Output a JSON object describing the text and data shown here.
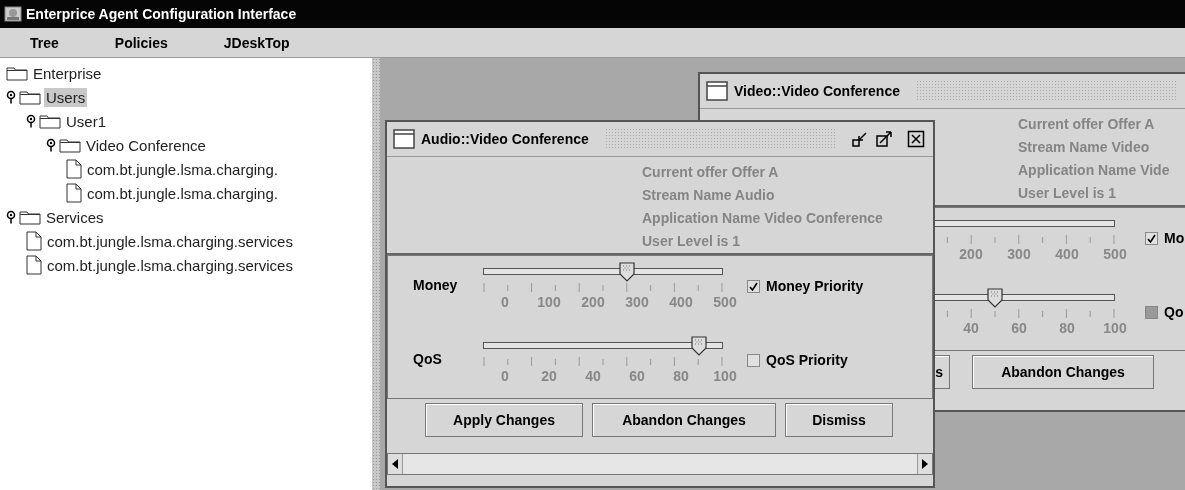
{
  "window": {
    "title": "Enterprice Agent Configuration Interface"
  },
  "menu": [
    {
      "label": "Tree"
    },
    {
      "label": "Policies"
    },
    {
      "label": "JDeskTop"
    }
  ],
  "tree": {
    "label": "Enterprise",
    "kind": "folder",
    "selected": false,
    "children": [
      {
        "label": "Users",
        "kind": "folder",
        "expanded": true,
        "selected": true,
        "children": [
          {
            "label": "User1",
            "kind": "folder",
            "expanded": true,
            "selected": false,
            "children": [
              {
                "label": "Video Conference",
                "kind": "folder",
                "expanded": true,
                "selected": false,
                "children": [
                  {
                    "label": "com.bt.jungle.lsma.charging.",
                    "kind": "leaf",
                    "selected": false
                  },
                  {
                    "label": "com.bt.jungle.lsma.charging.",
                    "kind": "leaf",
                    "selected": false
                  }
                ]
              }
            ]
          }
        ]
      },
      {
        "label": "Services",
        "kind": "folder",
        "expanded": true,
        "selected": false,
        "children": [
          {
            "label": "com.bt.jungle.lsma.charging.services",
            "kind": "leaf",
            "selected": false
          },
          {
            "label": "com.bt.jungle.lsma.charging.services",
            "kind": "leaf",
            "selected": false
          }
        ]
      }
    ]
  },
  "internal_frames": [
    {
      "title": "Video::Video Conference",
      "info_lines": [
        "Current offer Offer A",
        "Stream Name Video",
        "Application Name Vide",
        "User Level is  1"
      ],
      "sliders": [
        {
          "tick_labels": [
            "200",
            "300",
            "400",
            "500"
          ],
          "checkbox": {
            "label": "Mo",
            "checked": true,
            "disabled": false
          }
        },
        {
          "level": 0.5,
          "tick_labels": [
            "40",
            "60",
            "80",
            "100"
          ],
          "checkbox": {
            "label": "Qo",
            "checked": false,
            "disabled": true
          }
        }
      ],
      "buttons": [
        {
          "label": "s"
        },
        {
          "label": "Abandon Changes"
        }
      ]
    },
    {
      "title": "Audio::Video Conference",
      "title_controls": true,
      "scrollbar": true,
      "info_lines": [
        "Current offer Offer A",
        "Stream Name Audio",
        "Application Name Video Conference",
        "User Level is  1"
      ],
      "sliders": [
        {
          "label": "Money",
          "level": 0.6,
          "tick_labels": [
            "0",
            "100",
            "200",
            "300",
            "400",
            "500"
          ],
          "checkbox": {
            "label": "Money Priority",
            "checked": true,
            "disabled": false
          }
        },
        {
          "label": "QoS",
          "level": 0.9,
          "tick_labels": [
            "0",
            "20",
            "40",
            "60",
            "80",
            "100"
          ],
          "checkbox": {
            "label": "QoS Priority",
            "checked": false,
            "disabled": false
          }
        }
      ],
      "buttons": [
        {
          "label": "Apply Changes"
        },
        {
          "label": "Abandon Changes"
        },
        {
          "label": "Dismiss"
        }
      ]
    }
  ]
}
